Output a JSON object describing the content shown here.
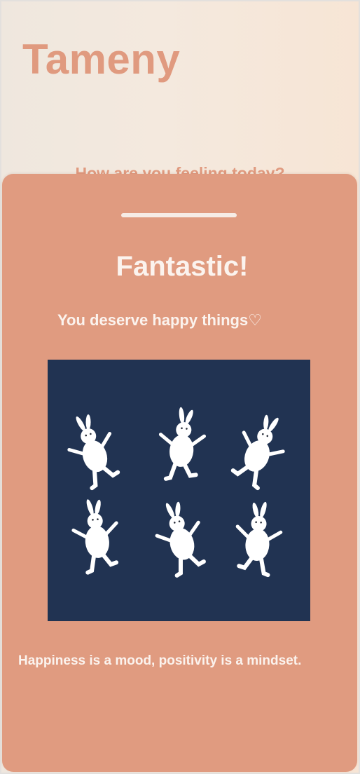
{
  "app": {
    "title": "Tameny"
  },
  "home": {
    "prompt": "How are you feeling today?"
  },
  "mood_sheet": {
    "title": "Fantastic!",
    "subtitle": "You deserve happy things♡",
    "image_icon": "dancing-bunnies-illustration",
    "quote": "Happiness is a mood, positivity is a mindset."
  },
  "colors": {
    "accent": "#e09a7f",
    "sheet": "#e09b80",
    "image_background": "#213352",
    "text_light": "#fbf3ee"
  }
}
